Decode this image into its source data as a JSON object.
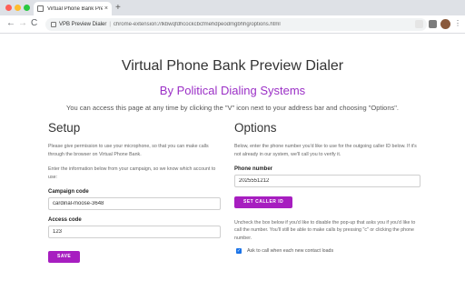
{
  "browser": {
    "tab_title": "Virtual Phone Bank Preview D...",
    "tab_close": "×",
    "new_tab": "+",
    "site_name": "VPB Preview Dialer",
    "url": "chrome-extension://lkbwqfdhcockcbcfmehdpeodmgbhhg/options.html",
    "separator": "|",
    "nav": {
      "back": "←",
      "forward": "→",
      "reload": "C"
    },
    "star_icon": "☆",
    "menu_icon": "⋮"
  },
  "page": {
    "title": "Virtual Phone Bank Preview Dialer",
    "subtitle": "By Political Dialing Systems",
    "intro": "You can access this page at any time by clicking the \"V\" icon next to your address bar and choosing \"Options\".",
    "accent_color": "#a71ec0"
  },
  "setup": {
    "heading": "Setup",
    "help1": "Please give permission to use your microphone, so that you can make calls through the browser on Virtual Phone Bank.",
    "help2": "Enter the information below from your campaign, so we know which account to use:",
    "campaign_code_label": "Campaign code",
    "campaign_code_value": "cardinal-moose-3648",
    "access_code_label": "Access code",
    "access_code_value": "123",
    "save_label": "SAVE"
  },
  "options": {
    "heading": "Options",
    "help1": "Below, enter the phone number you'd like to use for the outgoing caller ID below. If it's not already in our system, we'll call you to verify it.",
    "phone_label": "Phone number",
    "phone_value": "2025551212",
    "set_caller_id_label": "SET CALLER ID",
    "help2": "Uncheck the box below if you'd like to disable the pop-up that asks you if you'd like to call the number. You'll still be able to make calls by pressing \"c\" or clicking the phone number.",
    "checkbox_label": "Ask to call when each new contact loads",
    "checkbox_checked": true,
    "check_mark": "✓"
  }
}
